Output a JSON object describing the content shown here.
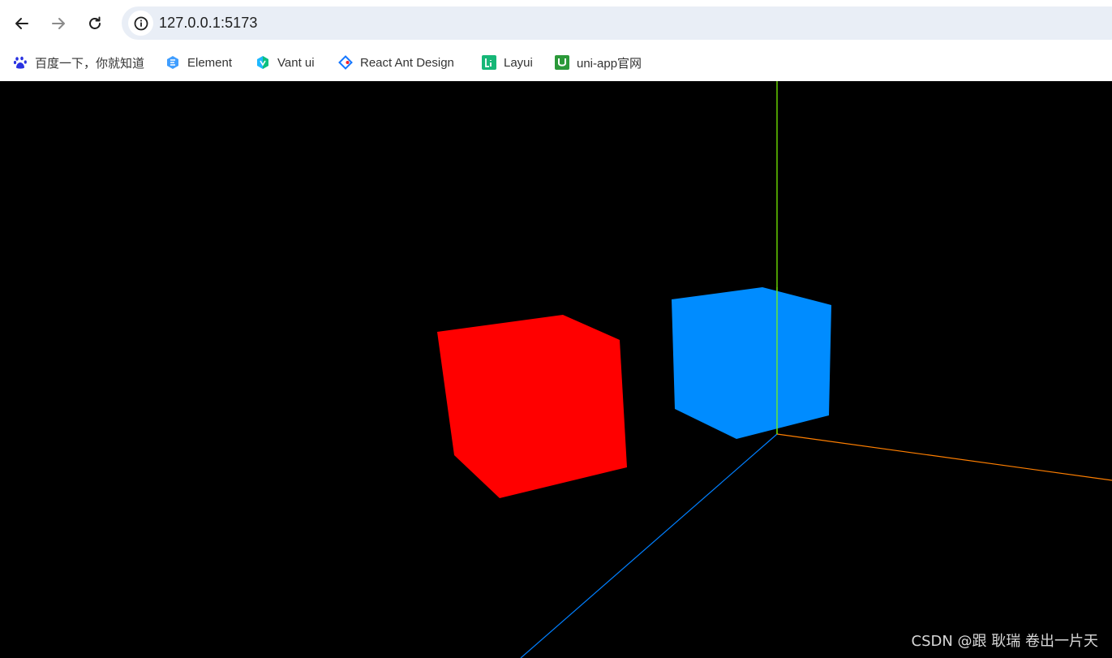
{
  "browser": {
    "address_bar": {
      "url": "127.0.0.1:5173"
    },
    "nav": {
      "back_icon": "arrow-left-icon",
      "forward_icon": "arrow-right-icon",
      "reload_icon": "reload-icon",
      "site_info_icon": "info-icon"
    },
    "bookmarks": [
      {
        "label": "百度一下，你就知道",
        "icon": "baidu-paw-icon",
        "color": "#2932e1"
      },
      {
        "label": "Element",
        "icon": "element-hexagon-icon",
        "color": "#409eff"
      },
      {
        "label": "Vant ui",
        "icon": "vant-hexagon-icon",
        "color": "#07c160"
      },
      {
        "label": "React Ant Design",
        "icon": "ant-design-diamond-icon",
        "color": "#1677ff"
      },
      {
        "label": "Layui",
        "icon": "layui-icon",
        "color": "#16b777"
      },
      {
        "label": "uni-app官网",
        "icon": "uniapp-u-icon",
        "color": "#2b9939"
      }
    ]
  },
  "scene": {
    "background": "#000000",
    "objects": [
      {
        "name": "red-cube",
        "color": "#ff0000"
      },
      {
        "name": "blue-cube",
        "color": "#008cff"
      }
    ],
    "axes": {
      "x_color": "#ff7f00",
      "y_color": "#7fff00",
      "z_color": "#007fff"
    }
  },
  "watermark": "CSDN @跟 耿瑞 卷出一片天"
}
